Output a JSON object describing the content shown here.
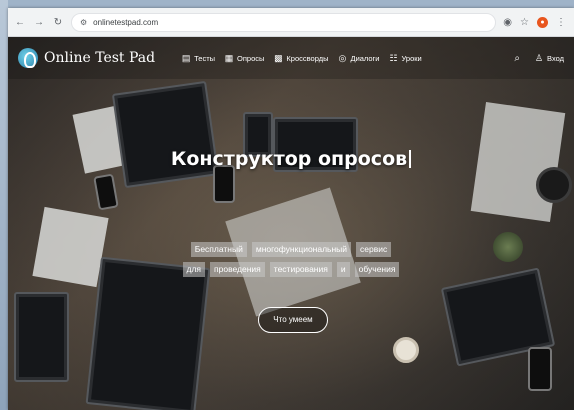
{
  "browser": {
    "url": "onlinetestpad.com",
    "back_icon": "arrow-left",
    "forward_icon": "arrow-right",
    "reload_icon": "reload",
    "site_info_icon": "tune",
    "icons": [
      "eye-off",
      "star",
      "extension",
      "menu-dots"
    ]
  },
  "navbar": {
    "logo_text": "Online Test Pad",
    "items": [
      {
        "label": "Тесты",
        "icon": "test-icon"
      },
      {
        "label": "Опросы",
        "icon": "poll-icon"
      },
      {
        "label": "Кроссворды",
        "icon": "crossword-icon"
      },
      {
        "label": "Диалоги",
        "icon": "dialog-icon"
      },
      {
        "label": "Уроки",
        "icon": "lesson-icon"
      }
    ],
    "login_label": "Вход"
  },
  "hero": {
    "title": "Конструктор опросов",
    "subtitle_line1": [
      "Бесплатный",
      "многофункциональный",
      "сервис"
    ],
    "subtitle_line2": [
      "для",
      "проведения",
      "тестирования",
      "и",
      "обучения"
    ],
    "cta_label": "Что умеем"
  },
  "colors": {
    "toolbar_bg": "#f1f3f4",
    "hero_overlay": "#3a3430",
    "chip_bg": "#c8c8c8",
    "text": "#ffffff"
  }
}
